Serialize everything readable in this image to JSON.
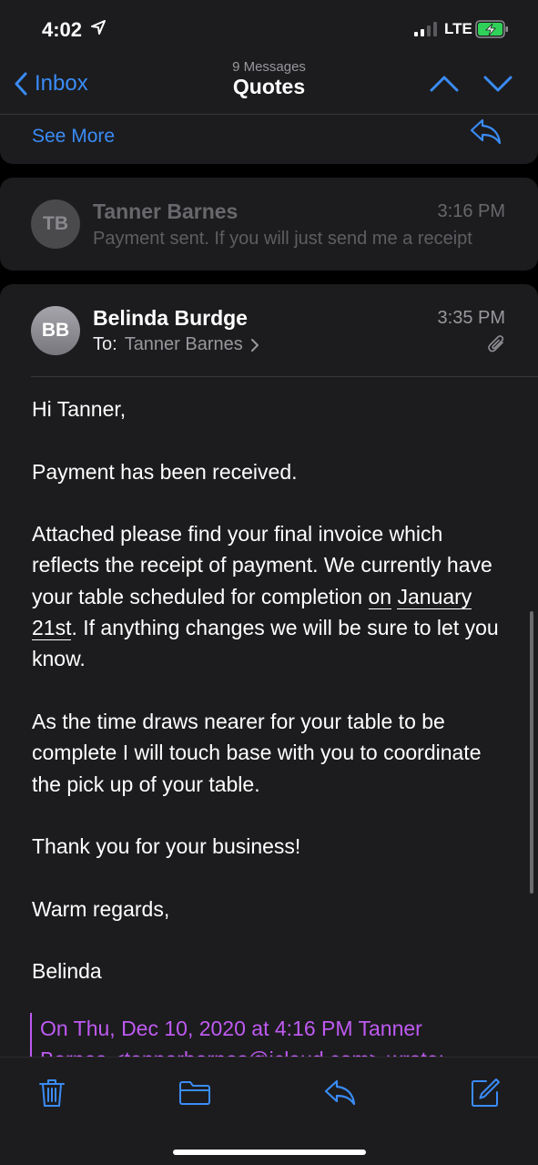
{
  "status": {
    "time": "4:02",
    "network": "LTE"
  },
  "nav": {
    "back_label": "Inbox",
    "message_count": "9 Messages",
    "title": "Quotes"
  },
  "thread_top": {
    "see_more": "See More"
  },
  "collapsed_message": {
    "initials": "TB",
    "sender": "Tanner Barnes",
    "time": "3:16 PM",
    "preview": "Payment sent. If you will just send me a receipt"
  },
  "message": {
    "initials": "BB",
    "sender": "Belinda Burdge",
    "to_label": "To:",
    "to_name": "Tanner Barnes",
    "time": "3:35 PM",
    "greeting": "Hi Tanner,",
    "p1": "Payment has been received.",
    "p2_a": "Attached please find your final invoice which reflects the receipt of payment.  We currently have your table scheduled for completion ",
    "p2_link1": "on",
    "p2_link2": "January 21st",
    "p2_b": ".  If anything changes we will be sure to let you know.",
    "p3": "As the time draws nearer for your table to be complete I will touch base with you to coordinate the pick up of your table.",
    "p4": "Thank you for your business!",
    "p5": "Warm regards,",
    "p6": "Belinda",
    "quote_line1": "On Thu, Dec 10, 2020 at 4:16 PM Tanner",
    "quote_line2": "Barnes <tannerbarnes@icloud.com> wrote:"
  },
  "colors": {
    "accent": "#3a8cf7",
    "quote": "#bf5af2",
    "background": "#1c1c1e"
  },
  "toolbar": {
    "icons": [
      "trash-icon",
      "folder-icon",
      "reply-icon",
      "compose-icon"
    ]
  }
}
